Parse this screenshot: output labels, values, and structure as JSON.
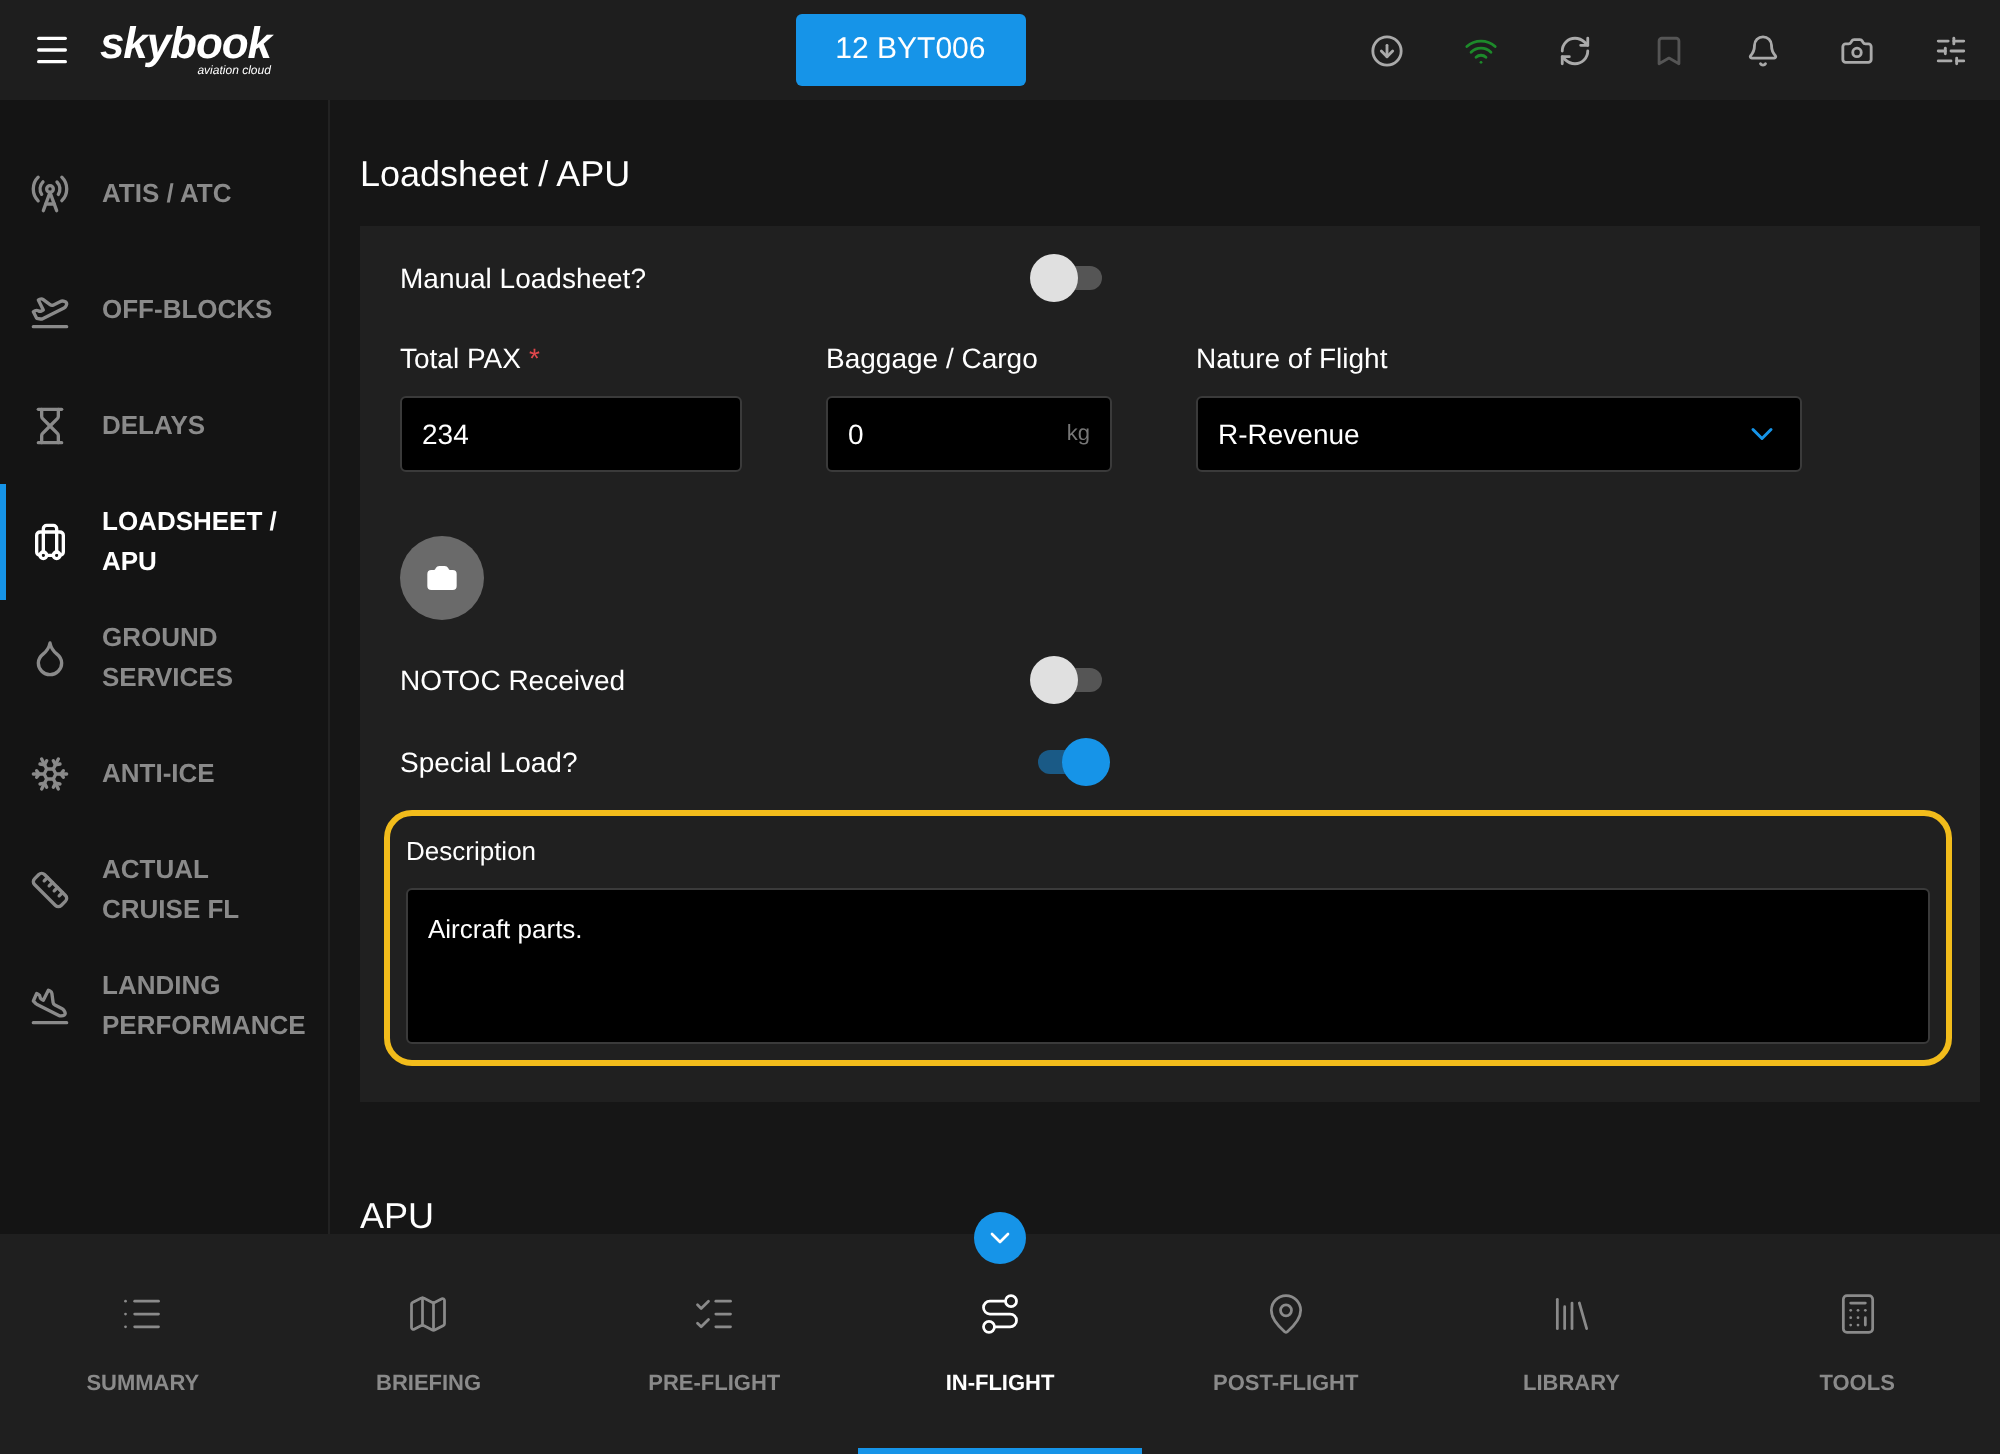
{
  "header": {
    "logo": "skybook",
    "logo_subtitle": "aviation cloud",
    "flight_button": "12 BYT006"
  },
  "sidebar": {
    "items": [
      {
        "label": "ATIS / ATC",
        "kind": "radio",
        "selected": false
      },
      {
        "label": "OFF-BLOCKS",
        "kind": "takeoff",
        "selected": false
      },
      {
        "label": "DELAYS",
        "kind": "hourglass",
        "selected": false
      },
      {
        "label": "LOADSHEET / APU",
        "kind": "luggage",
        "selected": true
      },
      {
        "label": "GROUND SERVICES",
        "kind": "fuel",
        "selected": false
      },
      {
        "label": "ANTI-ICE",
        "kind": "snow",
        "selected": false
      },
      {
        "label": "ACTUAL CRUISE FL",
        "kind": "ruler",
        "selected": false
      },
      {
        "label": "LANDING PERFORMANCE",
        "kind": "landing",
        "selected": false
      }
    ]
  },
  "section": {
    "title": "Loadsheet / APU",
    "manual_loadsheet": {
      "label": "Manual Loadsheet?",
      "on": false
    },
    "total_pax": {
      "label": "Total PAX",
      "required_mark": "*",
      "value": "234"
    },
    "baggage": {
      "label": "Baggage / Cargo",
      "value": "0",
      "unit": "kg"
    },
    "nature": {
      "label": "Nature of Flight",
      "value": "R-Revenue"
    },
    "notoc": {
      "label": "NOTOC Received",
      "on": false
    },
    "special_load": {
      "label": "Special Load?",
      "on": true
    },
    "description": {
      "label": "Description",
      "value": "Aircraft parts.",
      "highlighted": true
    }
  },
  "next_section": {
    "title": "APU"
  },
  "bottom_nav": [
    {
      "label": "SUMMARY",
      "kind": "list",
      "selected": false
    },
    {
      "label": "BRIEFING",
      "kind": "map",
      "selected": false
    },
    {
      "label": "PRE-FLIGHT",
      "kind": "checklist",
      "selected": false
    },
    {
      "label": "IN-FLIGHT",
      "kind": "route",
      "selected": true
    },
    {
      "label": "POST-FLIGHT",
      "kind": "pin",
      "selected": false
    },
    {
      "label": "LIBRARY",
      "kind": "library",
      "selected": false
    },
    {
      "label": "TOOLS",
      "kind": "calc",
      "selected": false
    }
  ]
}
